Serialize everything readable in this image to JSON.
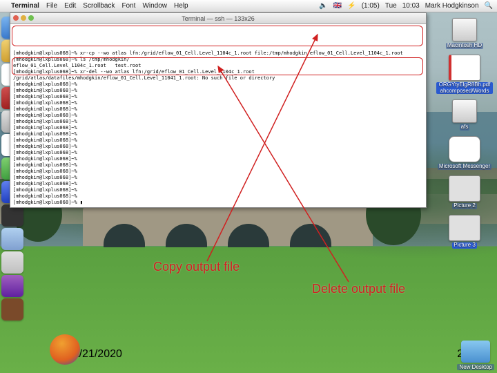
{
  "menubar": {
    "apple": "",
    "app": "Terminal",
    "items": [
      "File",
      "Edit",
      "Scrollback",
      "Font",
      "Window",
      "Help"
    ],
    "right": {
      "vol": "🔈",
      "flag": "🇬🇧",
      "batt": "⚡",
      "batt_label": "(1:05)",
      "day": "Tue",
      "time": "10:03",
      "user": "Mark Hodgkinson",
      "spotlight": "🔍"
    }
  },
  "terminal": {
    "title": "Terminal — ssh — 133x26",
    "lines": [
      "[mhodgkin@lxplus068]~% xr-cp --wo atlas lfn:/grid/eflow_01_Cell.Level_1104c_1.root file:/tmp/mhodgkin/eflow_01_Cell.Level_1104c_1.root",
      "[mhodgkin@lxplus068]~% ls /tmp/mhodgkin/",
      "eflow_01_Cell.Level_1104c_1.root   test.root",
      "[mhodgkin@lxplus068]~% xr-del --wo atlas lfn:/grid/eflow_01_Cell.Level_1104c_1.root",
      "/grid/atlas/datafiles/mhodgkin/eflow_01_Cell.Level_11041_1.root: No such file or directory",
      "[mhodgkin@lxplus068]~%",
      "[mhodgkin@lxplus068]~%",
      "[mhodgkin@lxplus068]~%",
      "[mhodgkin@lxplus068]~%",
      "[mhodgkin@lxplus068]~%",
      "[mhodgkin@lxplus068]~%",
      "[mhodgkin@lxplus068]~%",
      "[mhodgkin@lxplus068]~%",
      "[mhodgkin@lxplus068]~%",
      "[mhodgkin@lxplus068]~%",
      "[mhodgkin@lxplus068]~%",
      "[mhodgkin@lxplus068]~%",
      "[mhodgkin@lxplus068]~%",
      "[mhodgkin@lxplus068]~%",
      "[mhodgkin@lxplus068]~%",
      "[mhodgkin@lxplus068]~%",
      "[mhodgkin@lxplus068]~%",
      "[mhodgkin@lxplus068]~%",
      "[mhodgkin@lxplus068]~%",
      "[mhodgkin@lxplus068]~% ▮"
    ]
  },
  "desktop_icons": [
    {
      "name": "hd",
      "label": "Macintosh HD"
    },
    {
      "name": "pdf",
      "label": "ORGYtyElgR8Bh.pdf\nahcomposed/Words"
    },
    {
      "name": "afs",
      "label": "afs"
    },
    {
      "name": "msn",
      "label": "Microsoft Messenger"
    },
    {
      "name": "pic2",
      "label": "Picture 2"
    },
    {
      "name": "pic3",
      "label": "Picture 3"
    }
  ],
  "annotations": {
    "copy": "Copy output file",
    "delete": "Delete output file"
  },
  "new_desktop": "New Desktop",
  "slide": {
    "date": "11/21/2020",
    "page": "20"
  },
  "colors": {
    "annotation": "#d02020"
  }
}
